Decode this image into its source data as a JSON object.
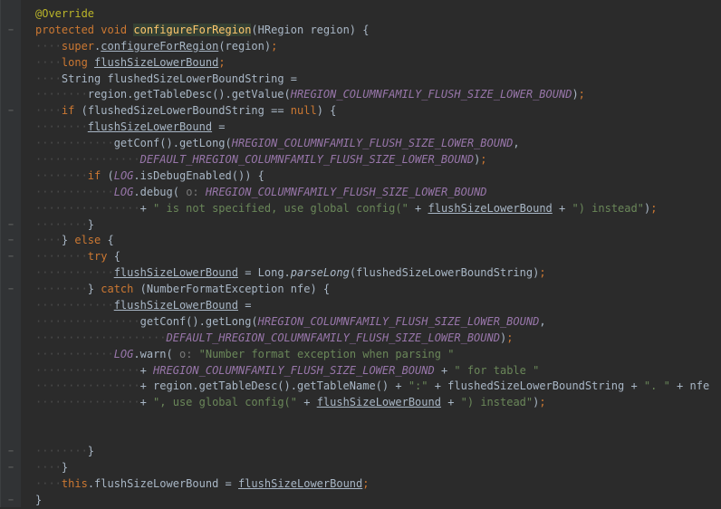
{
  "editor": {
    "language": "Java",
    "colors": {
      "background": "#2b2b2b",
      "keyword": "#cc7832",
      "annotation": "#bbb529",
      "method_declaration": "#ffc66d",
      "static_field": "#9876aa",
      "string": "#6a8759",
      "default_text": "#a9b7c6"
    },
    "icons": {
      "fold": "fold-marker-icon"
    },
    "lines": [
      {
        "fold": "",
        "tokens": [
          {
            "t": "@Override",
            "c": "ann"
          }
        ]
      },
      {
        "fold": "−",
        "tokens": [
          {
            "t": "protected void ",
            "c": "kw"
          },
          {
            "t": "configureForRegion",
            "c": "fn hl"
          },
          {
            "t": "(HRegion region) {"
          }
        ]
      },
      {
        "fold": "",
        "tokens": [
          {
            "t": "····",
            "c": "dots"
          },
          {
            "t": "super",
            "c": "kw"
          },
          {
            "t": "."
          },
          {
            "t": "configureForRegion",
            "c": "u"
          },
          {
            "t": "(region)"
          },
          {
            "t": ";",
            "c": "kw"
          }
        ]
      },
      {
        "fold": "",
        "tokens": [
          {
            "t": "····",
            "c": "dots"
          },
          {
            "t": "long ",
            "c": "kw"
          },
          {
            "t": "flushSizeLowerBound",
            "c": "u"
          },
          {
            "t": ";",
            "c": "kw"
          }
        ]
      },
      {
        "fold": "",
        "tokens": [
          {
            "t": "····",
            "c": "dots"
          },
          {
            "t": "String flushedSizeLowerBoundString ="
          }
        ]
      },
      {
        "fold": "",
        "tokens": [
          {
            "t": "········",
            "c": "dots"
          },
          {
            "t": "region.getTableDesc().getValue("
          },
          {
            "t": "HREGION_COLUMNFAMILY_FLUSH_SIZE_LOWER_BOUND",
            "c": "fld"
          },
          {
            "t": ")"
          },
          {
            "t": ";",
            "c": "kw"
          }
        ]
      },
      {
        "fold": "−",
        "tokens": [
          {
            "t": "····",
            "c": "dots"
          },
          {
            "t": "if ",
            "c": "kw"
          },
          {
            "t": "(flushedSizeLowerBoundString == "
          },
          {
            "t": "null",
            "c": "kw"
          },
          {
            "t": ") {"
          }
        ]
      },
      {
        "fold": "",
        "tokens": [
          {
            "t": "········",
            "c": "dots"
          },
          {
            "t": "flushSizeLowerBound",
            "c": "u"
          },
          {
            "t": " ="
          }
        ]
      },
      {
        "fold": "",
        "tokens": [
          {
            "t": "············",
            "c": "dots"
          },
          {
            "t": "getConf().getLong("
          },
          {
            "t": "HREGION_COLUMNFAMILY_FLUSH_SIZE_LOWER_BOUND",
            "c": "fld"
          },
          {
            "t": ","
          }
        ]
      },
      {
        "fold": "",
        "tokens": [
          {
            "t": "················",
            "c": "dots"
          },
          {
            "t": "DEFAULT_HREGION_COLUMNFAMILY_FLUSH_SIZE_LOWER_BOUND",
            "c": "fld"
          },
          {
            "t": ")"
          },
          {
            "t": ";",
            "c": "kw"
          }
        ]
      },
      {
        "fold": "",
        "tokens": [
          {
            "t": "········",
            "c": "dots"
          },
          {
            "t": "if ",
            "c": "kw"
          },
          {
            "t": "("
          },
          {
            "t": "LOG",
            "c": "fld"
          },
          {
            "t": ".isDebugEnabled()) {"
          }
        ]
      },
      {
        "fold": "",
        "tokens": [
          {
            "t": "············",
            "c": "dots"
          },
          {
            "t": "LOG",
            "c": "fld"
          },
          {
            "t": ".debug( "
          },
          {
            "t": "o: ",
            "c": "hint"
          },
          {
            "t": "HREGION_COLUMNFAMILY_FLUSH_SIZE_LOWER_BOUND",
            "c": "fld"
          }
        ]
      },
      {
        "fold": "",
        "tokens": [
          {
            "t": "················",
            "c": "dots"
          },
          {
            "t": "+ "
          },
          {
            "t": "\" is not specified, use global config(\"",
            "c": "str"
          },
          {
            "t": " + "
          },
          {
            "t": "flushSizeLowerBound",
            "c": "u"
          },
          {
            "t": " + "
          },
          {
            "t": "\") instead\"",
            "c": "str"
          },
          {
            "t": ")"
          },
          {
            "t": ";",
            "c": "kw"
          }
        ]
      },
      {
        "fold": "−",
        "tokens": [
          {
            "t": "········",
            "c": "dots"
          },
          {
            "t": "}"
          }
        ]
      },
      {
        "fold": "−",
        "tokens": [
          {
            "t": "····",
            "c": "dots"
          },
          {
            "t": "} "
          },
          {
            "t": "else ",
            "c": "kw"
          },
          {
            "t": "{"
          }
        ]
      },
      {
        "fold": "−",
        "tokens": [
          {
            "t": "········",
            "c": "dots"
          },
          {
            "t": "try ",
            "c": "kw"
          },
          {
            "t": "{"
          }
        ]
      },
      {
        "fold": "",
        "tokens": [
          {
            "t": "············",
            "c": "dots"
          },
          {
            "t": "flushSizeLowerBound",
            "c": "u"
          },
          {
            "t": " = Long."
          },
          {
            "t": "parseLong",
            "c": "mth"
          },
          {
            "t": "(flushedSizeLowerBoundString)"
          },
          {
            "t": ";",
            "c": "kw"
          }
        ]
      },
      {
        "fold": "−",
        "tokens": [
          {
            "t": "········",
            "c": "dots"
          },
          {
            "t": "} "
          },
          {
            "t": "catch ",
            "c": "kw"
          },
          {
            "t": "(NumberFormatException nfe) {"
          }
        ]
      },
      {
        "fold": "",
        "tokens": [
          {
            "t": "············",
            "c": "dots"
          },
          {
            "t": "flushSizeLowerBound",
            "c": "u"
          },
          {
            "t": " ="
          }
        ]
      },
      {
        "fold": "",
        "tokens": [
          {
            "t": "················",
            "c": "dots"
          },
          {
            "t": "getConf().getLong("
          },
          {
            "t": "HREGION_COLUMNFAMILY_FLUSH_SIZE_LOWER_BOUND",
            "c": "fld"
          },
          {
            "t": ","
          }
        ]
      },
      {
        "fold": "",
        "tokens": [
          {
            "t": "····················",
            "c": "dots"
          },
          {
            "t": "DEFAULT_HREGION_COLUMNFAMILY_FLUSH_SIZE_LOWER_BOUND",
            "c": "fld"
          },
          {
            "t": ")"
          },
          {
            "t": ";",
            "c": "kw"
          }
        ]
      },
      {
        "fold": "",
        "tokens": [
          {
            "t": "············",
            "c": "dots"
          },
          {
            "t": "LOG",
            "c": "fld"
          },
          {
            "t": ".warn( "
          },
          {
            "t": "o: ",
            "c": "hint"
          },
          {
            "t": "\"Number format exception when parsing \"",
            "c": "str"
          }
        ]
      },
      {
        "fold": "",
        "tokens": [
          {
            "t": "················",
            "c": "dots"
          },
          {
            "t": "+ "
          },
          {
            "t": "HREGION_COLUMNFAMILY_FLUSH_SIZE_LOWER_BOUND",
            "c": "fld"
          },
          {
            "t": " + "
          },
          {
            "t": "\" for table \"",
            "c": "str"
          }
        ]
      },
      {
        "fold": "",
        "tokens": [
          {
            "t": "················",
            "c": "dots"
          },
          {
            "t": "+ region.getTableDesc().getTableName() + "
          },
          {
            "t": "\":\"",
            "c": "str"
          },
          {
            "t": " + flushedSizeLowerBoundString + "
          },
          {
            "t": "\". \"",
            "c": "str"
          },
          {
            "t": " + nfe"
          }
        ]
      },
      {
        "fold": "",
        "tokens": [
          {
            "t": "················",
            "c": "dots"
          },
          {
            "t": "+ "
          },
          {
            "t": "\", use global config(\"",
            "c": "str"
          },
          {
            "t": " + "
          },
          {
            "t": "flushSizeLowerBound",
            "c": "u"
          },
          {
            "t": " + "
          },
          {
            "t": "\") instead\"",
            "c": "str"
          },
          {
            "t": ")"
          },
          {
            "t": ";",
            "c": "kw"
          }
        ]
      },
      {
        "fold": "",
        "tokens": []
      },
      {
        "fold": "",
        "tokens": []
      },
      {
        "fold": "−",
        "tokens": [
          {
            "t": "········",
            "c": "dots"
          },
          {
            "t": "}"
          }
        ]
      },
      {
        "fold": "−",
        "tokens": [
          {
            "t": "····",
            "c": "dots"
          },
          {
            "t": "}"
          }
        ]
      },
      {
        "fold": "",
        "tokens": [
          {
            "t": "····",
            "c": "dots"
          },
          {
            "t": "this",
            "c": "kw"
          },
          {
            "t": ".flushSizeLowerBound = "
          },
          {
            "t": "flushSizeLowerBound",
            "c": "u"
          },
          {
            "t": ";",
            "c": "kw"
          }
        ]
      },
      {
        "fold": "−",
        "tokens": [
          {
            "t": "}"
          }
        ]
      }
    ]
  }
}
